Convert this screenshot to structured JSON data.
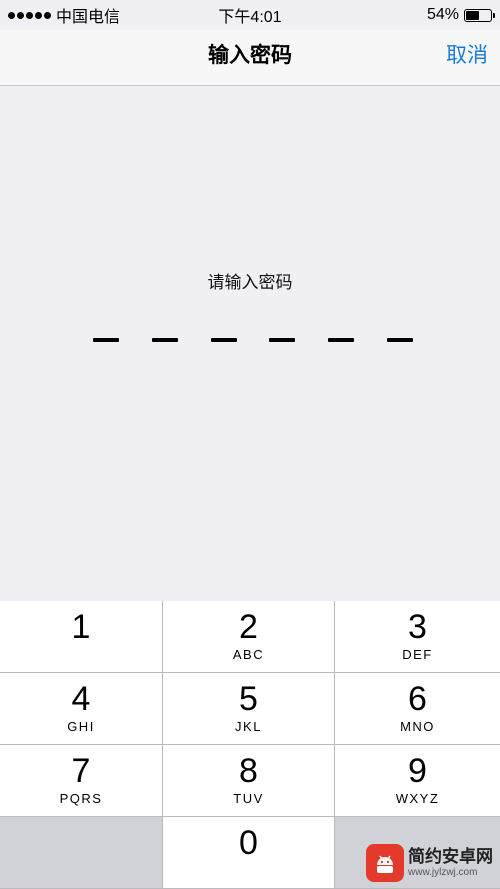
{
  "status_bar": {
    "carrier": "中国电信",
    "time": "下午4:01",
    "battery_percent": "54%",
    "battery_level": 0.54,
    "signal_dots": 5
  },
  "nav": {
    "title": "输入密码",
    "cancel_label": "取消"
  },
  "passcode": {
    "prompt": "请输入密码",
    "length": 6
  },
  "keypad": {
    "keys": [
      {
        "digit": "1",
        "letters": ""
      },
      {
        "digit": "2",
        "letters": "ABC"
      },
      {
        "digit": "3",
        "letters": "DEF"
      },
      {
        "digit": "4",
        "letters": "GHI"
      },
      {
        "digit": "5",
        "letters": "JKL"
      },
      {
        "digit": "6",
        "letters": "MNO"
      },
      {
        "digit": "7",
        "letters": "PQRS"
      },
      {
        "digit": "8",
        "letters": "TUV"
      },
      {
        "digit": "9",
        "letters": "WXYZ"
      },
      {
        "digit": "0",
        "letters": ""
      }
    ]
  },
  "watermark": {
    "name": "简约安卓网",
    "url": "www.jylzwj.com"
  },
  "colors": {
    "accent": "#1a7bd6",
    "background": "#efeff4",
    "keypad_bg": "#d1d2d8"
  }
}
